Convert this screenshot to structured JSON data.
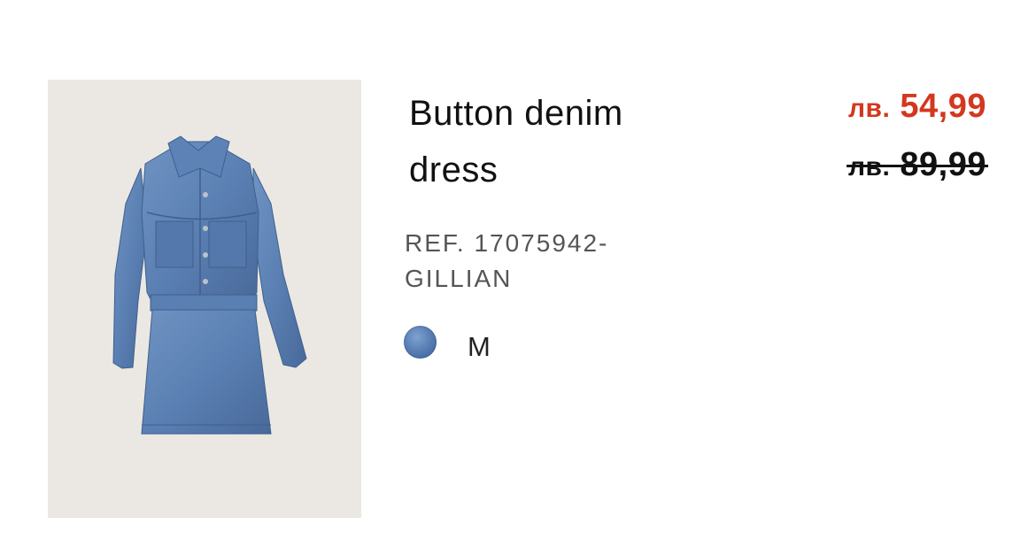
{
  "product": {
    "title_line1": "Button denim",
    "title_line2": "dress",
    "ref_line1": "REF. 17075942-",
    "ref_line2": "GILLIAN",
    "sale_price_currency": "лв.",
    "sale_price_amount": "54,99",
    "original_price_currency": "лв.",
    "original_price_amount": "89,99",
    "size": "M",
    "color_swatch": "#5a80b6",
    "image_icon": "denim-dress-photo"
  },
  "colors": {
    "sale": "#d3381f",
    "text": "#111111",
    "ref": "#555555",
    "image_bg": "#ebe8e3"
  }
}
